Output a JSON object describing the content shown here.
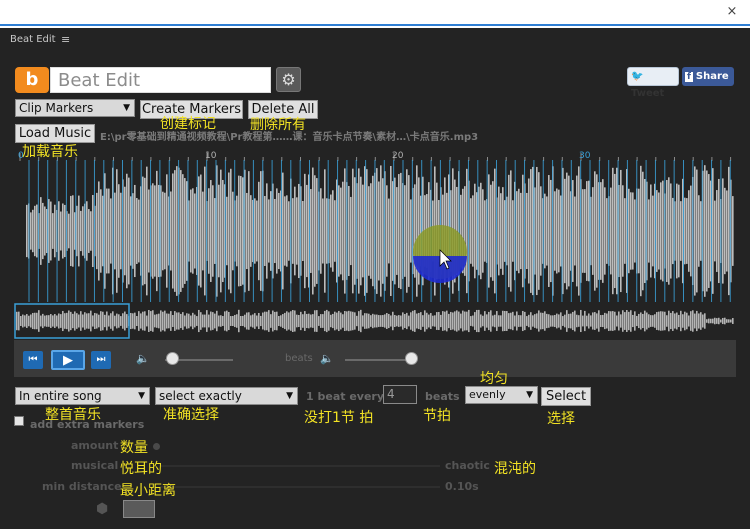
{
  "window": {
    "close_glyph": "×"
  },
  "panel": {
    "title": "Beat Edit",
    "menu_glyph": "≡"
  },
  "header": {
    "logo_letter": "b",
    "title": "Beat Edit",
    "tweet_label": "Tweet",
    "share_label": "Share"
  },
  "toolbar": {
    "marker_type": "Clip Markers",
    "create_markers": "Create Markers",
    "delete_all": "Delete All",
    "load_music": "Load Music",
    "file_path": "E:\\pr零基础到精通视频教程\\Pr教程第……课：音乐卡点节奏\\素材…\\卡点音乐.mp3"
  },
  "ruler": {
    "labels": [
      "0",
      "10",
      "20",
      "30"
    ]
  },
  "annotations": {
    "create_markers": "创建标记",
    "delete_all": "删除所有",
    "load_music": "加载音乐",
    "entire_song": "整首音乐",
    "select_exactly": "准确选择",
    "every_beat": "没打1节 拍",
    "beats": "节拍",
    "evenly": "均匀",
    "select": "选择",
    "amount": "数量",
    "musical": "悦耳的",
    "chaotic": "混沌的",
    "min_distance": "最小距离"
  },
  "controls": {
    "range": "In entire song",
    "mode": "select exactly",
    "one_beat_every": "1 beat every",
    "beat_count": "4",
    "beats": "beats",
    "distribution": "evenly",
    "select_button": "Select",
    "add_extra_markers": "add extra markers",
    "amount": "amount",
    "musical": "musical",
    "chaotic": "chaotic",
    "min_distance": "min distance",
    "min_distance_value": "0.10s",
    "beats_volume_label": "beats"
  },
  "colors": {
    "accent": "#1f6ab3",
    "marker": "#3aa0d8",
    "annotation": "#f2e224",
    "panel": "#232323"
  }
}
